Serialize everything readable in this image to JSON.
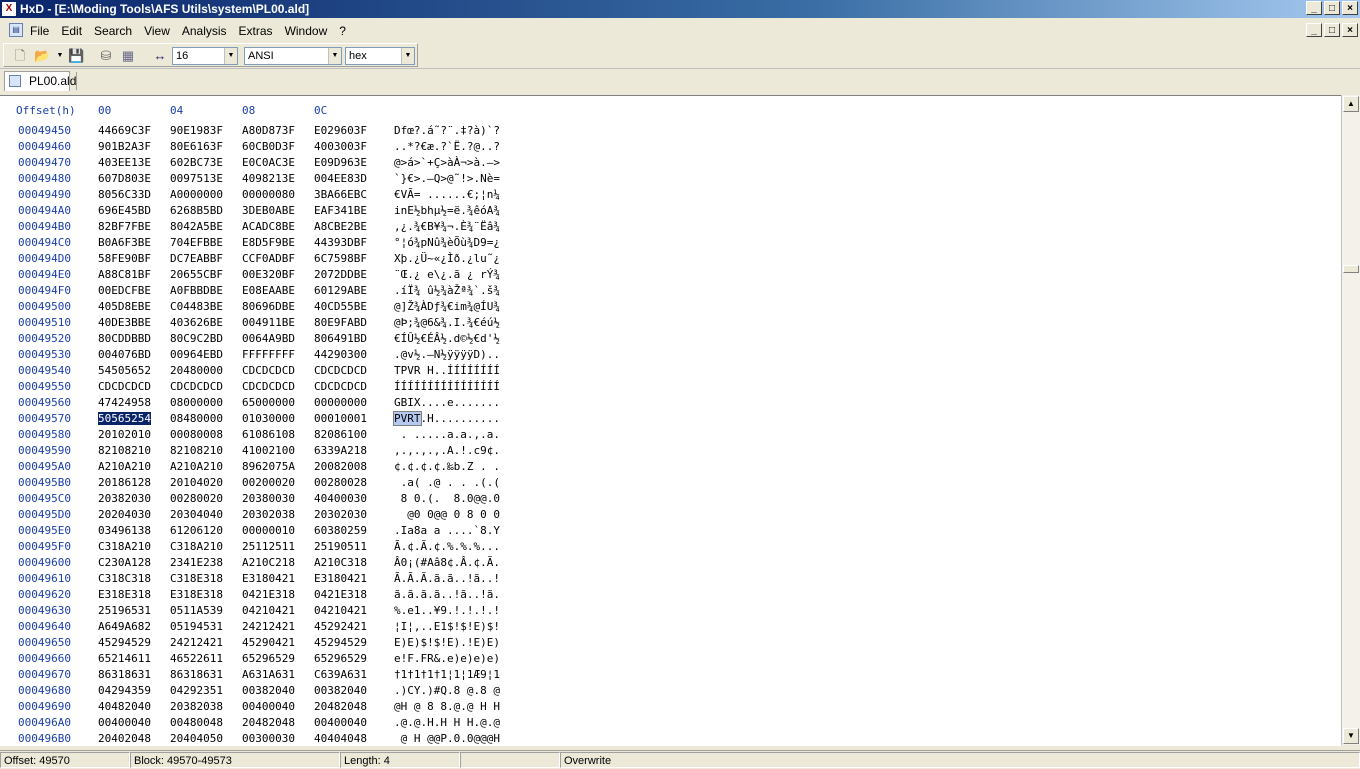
{
  "window": {
    "title": "HxD - [E:\\Moding Tools\\AFS Utils\\system\\PL00.ald]",
    "app_icon": "hxd-app-icon"
  },
  "menu": {
    "items": [
      "File",
      "Edit",
      "Search",
      "View",
      "Analysis",
      "Extras",
      "Window",
      "?"
    ]
  },
  "toolbar": {
    "bytes_per_row": "16",
    "charset": "ANSI",
    "offset_base": "hex",
    "icons": [
      "new-file-icon",
      "open-file-icon",
      "dropdown-arrow-icon",
      "save-icon",
      "disk-icon",
      "ram-icon",
      "columns-width-icon"
    ]
  },
  "tab": {
    "label": "PL00.ald"
  },
  "hex_view": {
    "header": {
      "offset": "Offset(h)",
      "cols": [
        "00",
        "04",
        "08",
        "0C"
      ]
    },
    "selected_offset": "00049570",
    "rows": [
      {
        "off": "00049450",
        "g": [
          "44669C3F",
          "90E1983F",
          "A80D873F",
          "E029603F"
        ],
        "a": "Dfœ?.á˜?¨.‡?à)`?"
      },
      {
        "off": "00049460",
        "g": [
          "901B2A3F",
          "80E6163F",
          "60CB0D3F",
          "4003003F"
        ],
        "a": "..*?€æ.?`Ë.?@..?"
      },
      {
        "off": "00049470",
        "g": [
          "403EE13E",
          "602BC73E",
          "E0C0AC3E",
          "E09D963E"
        ],
        "a": "@>á>`+Ç>àÀ¬>à.–>"
      },
      {
        "off": "00049480",
        "g": [
          "607D803E",
          "0097513E",
          "4098213E",
          "004EE83D"
        ],
        "a": "`}€>.—Q>@˜!>.Nè="
      },
      {
        "off": "00049490",
        "g": [
          "8056C33D",
          "A0000000",
          "00000080",
          "3BA66EBC"
        ],
        "a": "€VÃ= ......€;¦n¼"
      },
      {
        "off": "000494A0",
        "g": [
          "696E45BD",
          "6268B5BD",
          "3DEB0ABE",
          "EAF341BE"
        ],
        "a": "inE½bhµ½=ë.¾êóA¾"
      },
      {
        "off": "000494B0",
        "g": [
          "82BF7FBE",
          "8042A5BE",
          "ACADC8BE",
          "A8CBE2BE"
        ],
        "a": "‚¿.¾€B¥¾¬.È¾¨Ëâ¾"
      },
      {
        "off": "000494C0",
        "g": [
          "B0A6F3BE",
          "704EFBBE",
          "E8D5F9BE",
          "44393DBF"
        ],
        "a": "°¦ó¾pNû¾èÕù¾D9=¿"
      },
      {
        "off": "000494D0",
        "g": [
          "58FE90BF",
          "DC7EABBF",
          "CCF0ADBF",
          "6C7598BF"
        ],
        "a": "Xþ.¿Ü~«¿Ìð.¿lu˜¿"
      },
      {
        "off": "000494E0",
        "g": [
          "A88C81BF",
          "20655CBF",
          "00E320BF",
          "2072DDBE"
        ],
        "a": "¨Œ.¿ e\\¿.ã ¿ rÝ¾"
      },
      {
        "off": "000494F0",
        "g": [
          "00EDCFBE",
          "A0FBBDBE",
          "E08EAABE",
          "60129ABE"
        ],
        "a": ".íÏ¾ û½¾àŽª¾`.š¾"
      },
      {
        "off": "00049500",
        "g": [
          "405D8EBE",
          "C04483BE",
          "80696DBE",
          "40CD55BE"
        ],
        "a": "@]Ž¾ÀDƒ¾€im¾@ÍU¾"
      },
      {
        "off": "00049510",
        "g": [
          "40DE3BBE",
          "403626BE",
          "004911BE",
          "80E9FABD"
        ],
        "a": "@Þ;¾@6&¾.I.¾€éú½"
      },
      {
        "off": "00049520",
        "g": [
          "80CDDBBD",
          "80C9C2BD",
          "0064A9BD",
          "806491BD"
        ],
        "a": "€ÍÛ½€ÉÂ½.d©½€d'½"
      },
      {
        "off": "00049530",
        "g": [
          "004076BD",
          "00964EBD",
          "FFFFFFFF",
          "44290300"
        ],
        "a": ".@v½.–N½ÿÿÿÿD).."
      },
      {
        "off": "00049540",
        "g": [
          "54505652",
          "20480000",
          "CDCDCDCD",
          "CDCDCDCD"
        ],
        "a": "TPVR H..ÍÍÍÍÍÍÍÍ"
      },
      {
        "off": "00049550",
        "g": [
          "CDCDCDCD",
          "CDCDCDCD",
          "CDCDCDCD",
          "CDCDCDCD"
        ],
        "a": "ÍÍÍÍÍÍÍÍÍÍÍÍÍÍÍÍ"
      },
      {
        "off": "00049560",
        "g": [
          "47424958",
          "08000000",
          "65000000",
          "00000000"
        ],
        "a": "GBIX....e......."
      },
      {
        "off": "00049570",
        "g": [
          "50565254",
          "08480000",
          "01030000",
          "00010001"
        ],
        "a": "PVRT.H.........."
      },
      {
        "off": "00049580",
        "g": [
          "20102010",
          "00080008",
          "61086108",
          "82086100"
        ],
        "a": " . .....a.a.‚.a."
      },
      {
        "off": "00049590",
        "g": [
          "82108210",
          "82108210",
          "41002100",
          "6339A218"
        ],
        "a": "‚.‚.‚.‚.A.!.c9¢."
      },
      {
        "off": "000495A0",
        "g": [
          "A210A210",
          "A210A210",
          "8962075A",
          "20082008"
        ],
        "a": "¢.¢.¢.¢.‰b.Z . ."
      },
      {
        "off": "000495B0",
        "g": [
          "20186128",
          "20104020",
          "00200020",
          "00280028"
        ],
        "a": " .a( .@ . . .(.("
      },
      {
        "off": "000495C0",
        "g": [
          "20382030",
          "00280020",
          "20380030",
          "40400030"
        ],
        "a": " 8 0.(.  8.0@@.0"
      },
      {
        "off": "000495D0",
        "g": [
          "20204030",
          "20304040",
          "20302038",
          "20302030"
        ],
        "a": "  @0 0@@ 0 8 0 0"
      },
      {
        "off": "000495E0",
        "g": [
          "03496138",
          "61206120",
          "00000010",
          "60380259"
        ],
        "a": ".Ia8a a ....`8.Y"
      },
      {
        "off": "000495F0",
        "g": [
          "C318A210",
          "C318A210",
          "25112511",
          "25190511"
        ],
        "a": "Ã.¢.Ã.¢.%.%.%..."
      },
      {
        "off": "00049600",
        "g": [
          "C230A128",
          "2341E238",
          "A210C218",
          "A210C318"
        ],
        "a": "Â0¡(#Aâ8¢.Â.¢.Ã."
      },
      {
        "off": "00049610",
        "g": [
          "C318C318",
          "C318E318",
          "E3180421",
          "E3180421"
        ],
        "a": "Ã.Ã.Ã.ã.ã..!ã..!"
      },
      {
        "off": "00049620",
        "g": [
          "E318E318",
          "E318E318",
          "0421E318",
          "0421E318"
        ],
        "a": "ã.ã.ã.ã..!ã..!ã."
      },
      {
        "off": "00049630",
        "g": [
          "25196531",
          "0511A539",
          "04210421",
          "04210421"
        ],
        "a": "%.e1..¥9.!.!.!.!"
      },
      {
        "off": "00049640",
        "g": [
          "A649A682",
          "05194531",
          "24212421",
          "45292421"
        ],
        "a": "¦I¦‚..E1$!$!E)$!"
      },
      {
        "off": "00049650",
        "g": [
          "45294529",
          "24212421",
          "45290421",
          "45294529"
        ],
        "a": "E)E)$!$!E).!E)E)"
      },
      {
        "off": "00049660",
        "g": [
          "65214611",
          "46522611",
          "65296529",
          "65296529"
        ],
        "a": "e!F.FR&.e)e)e)e)"
      },
      {
        "off": "00049670",
        "g": [
          "86318631",
          "86318631",
          "A631A631",
          "C639A631"
        ],
        "a": "†1†1†1†1¦1¦1Æ9¦1"
      },
      {
        "off": "00049680",
        "g": [
          "04294359",
          "04292351",
          "00382040",
          "00382040"
        ],
        "a": ".)CY.)#Q.8 @.8 @"
      },
      {
        "off": "00049690",
        "g": [
          "40482040",
          "20382038",
          "00400040",
          "20482048"
        ],
        "a": "@H @ 8 8.@.@ H H"
      },
      {
        "off": "000496A0",
        "g": [
          "00400040",
          "00480048",
          "20482048",
          "00400040"
        ],
        "a": ".@.@.H.H H H.@.@"
      },
      {
        "off": "000496B0",
        "g": [
          "20402048",
          "20404050",
          "00300030",
          "40404048"
        ],
        "a": " @ H @@P.0.0@@@H"
      }
    ]
  },
  "status": {
    "offset": "Offset: 49570",
    "block": "Block: 49570-49573",
    "length": "Length: 4",
    "mode": "Overwrite"
  }
}
